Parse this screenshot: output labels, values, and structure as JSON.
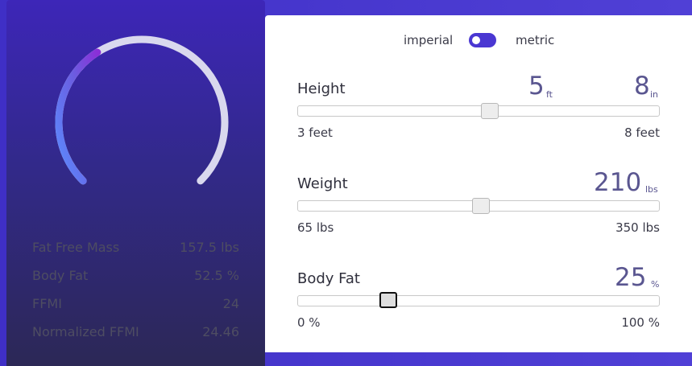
{
  "results": {
    "gauge": {
      "fill_fraction": 0.38
    },
    "stats": [
      {
        "label": "Fat Free Mass",
        "value": "157.5 lbs"
      },
      {
        "label": "Body Fat",
        "value": "52.5 %"
      },
      {
        "label": "FFMI",
        "value": "24"
      },
      {
        "label": "Normalized FFMI",
        "value": "24.46"
      }
    ]
  },
  "units": {
    "left_label": "imperial",
    "right_label": "metric",
    "selected": "imperial"
  },
  "height": {
    "title": "Height",
    "feet": "5",
    "feet_unit": "ft",
    "inches": "8",
    "inches_unit": "in",
    "min_label": "3 feet",
    "max_label": "8 feet",
    "position": 0.53
  },
  "weight": {
    "title": "Weight",
    "value": "210",
    "unit": "lbs",
    "min_label": "65 lbs",
    "max_label": "350 lbs",
    "position": 0.507
  },
  "bodyfat": {
    "title": "Body Fat",
    "value": "25",
    "unit": "%",
    "min_label": "0 %",
    "max_label": "100 %",
    "position": 0.25
  },
  "colors": {
    "accent": "#4a37d2",
    "gauge_fill": "#8a3ae0",
    "gauge_track": "#d9d8ee"
  }
}
